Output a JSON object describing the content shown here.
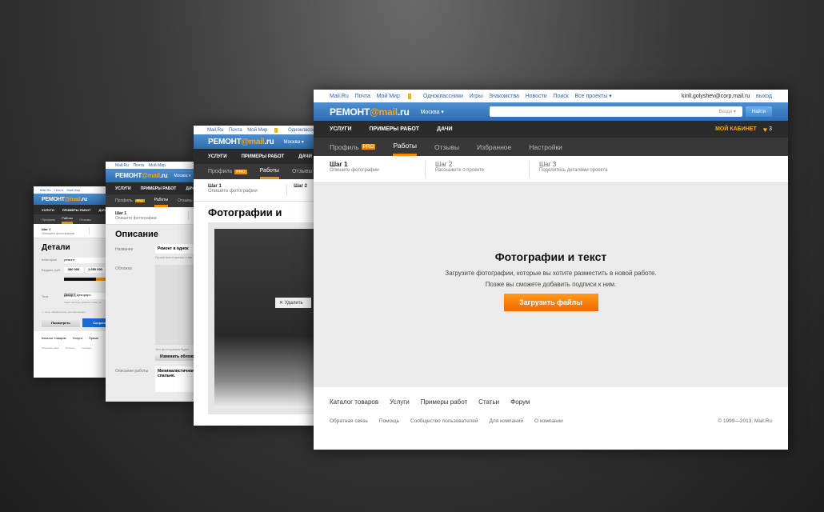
{
  "common": {
    "top_links": [
      "Mail.Ru",
      "Почта",
      "Мой Мир",
      "Одноклассники",
      "Игры",
      "Знакомства",
      "Новости",
      "Поиск",
      "Все проекты ▾"
    ],
    "moi_mir_badge": "1",
    "logo_text": "РЕМОНТ",
    "logo_at": "@mail",
    "logo_ru": ".ru",
    "city": "Москва ▾",
    "nav": [
      "УСЛУГИ",
      "ПРИМЕРЫ РАБОТ",
      "ДАЧИ"
    ],
    "tabs": [
      "Профиль",
      "Работы",
      "Отзывы",
      "Избранное",
      "Настройки"
    ],
    "pro": "PRO",
    "steps": [
      {
        "title": "Шаг 1",
        "desc": "Опишите фотографии"
      },
      {
        "title": "Шаг 2",
        "desc": "Расскажите о проекте"
      },
      {
        "title": "Шаг 3",
        "desc": "Поделитесь деталями проекта"
      }
    ]
  },
  "main": {
    "user": "kirill.golyshev@corp.mail.ru",
    "logout": "выход",
    "search_scope": "Везде ▾",
    "search_button": "Найти",
    "cabinet": "МОЙ КАБИНЕТ",
    "favorites_count": "3",
    "heading": "Фотографии и текст",
    "text1": "Загрузите фотографии, которые вы хотите разместить в новой работе.",
    "text2": "Позже вы сможете добавить подписи к ним.",
    "upload_button": "Загрузить файлы",
    "footer_links": [
      "Каталог товаров",
      "Услуги",
      "Примеры работ",
      "Статьи",
      "Форум"
    ],
    "footer_small": [
      "Обратная связь",
      "Помощь",
      "Сообщество пользователей",
      "Для компаний",
      "О компании"
    ],
    "copyright": "© 1999—2013, Mail.Ru"
  },
  "win3": {
    "heading": "Фотографии и текст",
    "delete": "✕ Удалить"
  },
  "win2": {
    "heading": "Описание",
    "name_label": "Название",
    "name_value": "Ремонт в однок",
    "name_hint": "Лучше всего кратко и ем",
    "cover_label": "Обложка",
    "cover_hint": "Эта фотография будет",
    "change_cover": "Изменить обложку",
    "desc_label": "Описание работы",
    "desc_value": "Минималистичная к спальне."
  },
  "win1": {
    "heading": "Детали",
    "category_label": "Категория",
    "category_value": "ремонт",
    "budget_label": "Бюджет, руб.",
    "budget_from": "380 000",
    "budget_to": "1 050 000",
    "tags_label": "Теги",
    "tag": "Декор ×",
    "tag_input": "Декориро",
    "tags_hint": "Через запятую укажите слова, за",
    "required_note": "— поля, обязательные для заполнения",
    "preview_button": "Посмотреть",
    "save_button": "Сохранить",
    "footer_links": [
      "Каталог товаров",
      "Услуги",
      "Приме"
    ],
    "footer_small": [
      "Обратная связь",
      "Помощь",
      "Сообщес"
    ]
  },
  "colors": {
    "accent": "#f08c00",
    "header_blue": "#3a7cc0",
    "dark_nav": "#2b2b2b"
  }
}
